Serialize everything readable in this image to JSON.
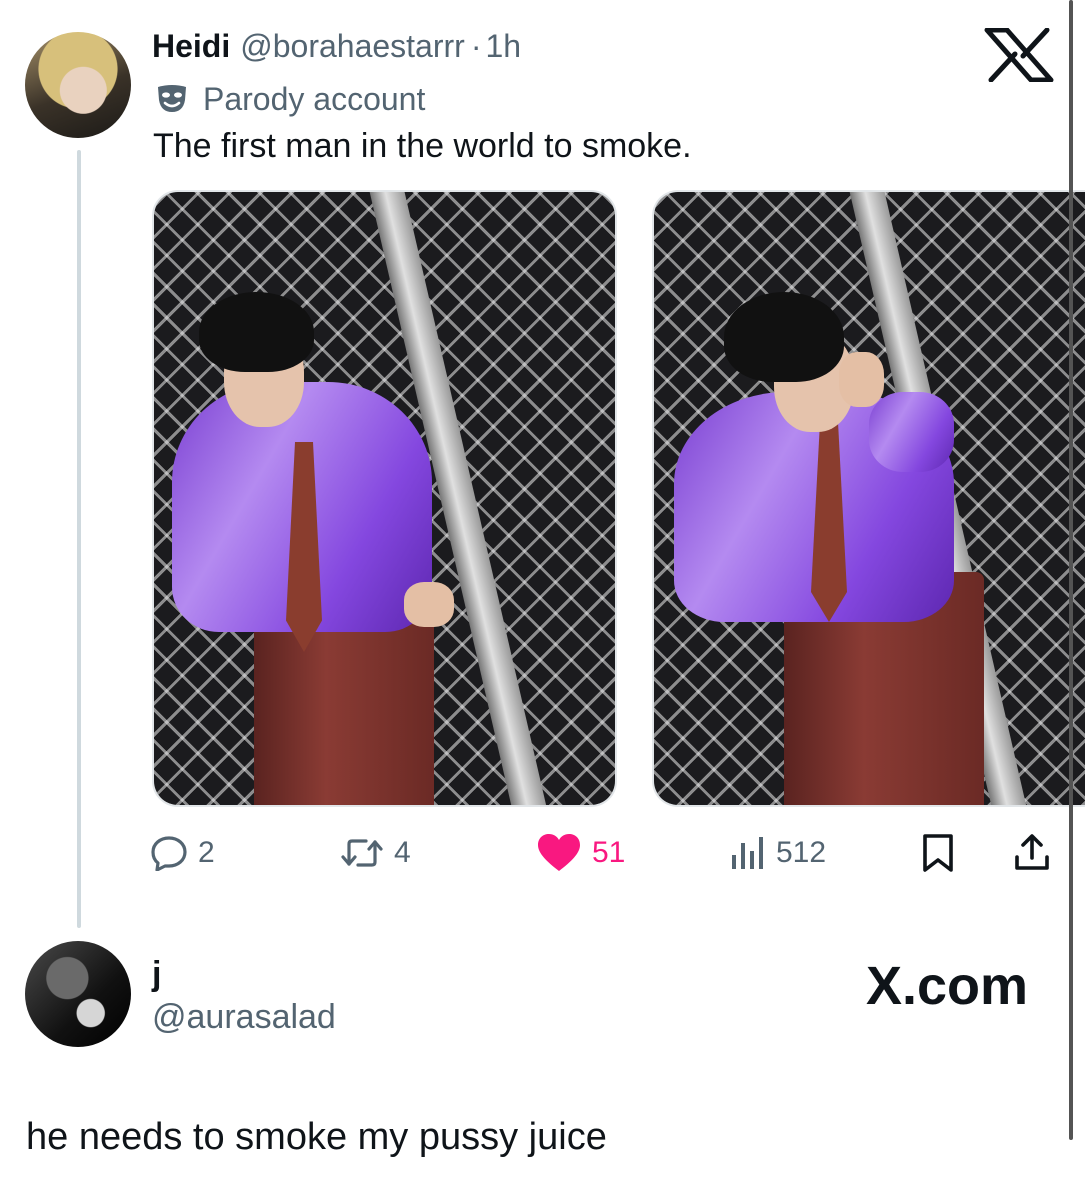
{
  "tweet": {
    "name": "Heidi",
    "handle": "@borahaestarrr",
    "separator": "·",
    "time": "1h",
    "label": "Parody account",
    "text": "The first man in the world to smoke.",
    "actions": {
      "replies": "2",
      "reposts": "4",
      "likes": "51",
      "views": "512"
    },
    "like_color": "#f91880"
  },
  "reply": {
    "name": "j",
    "handle": "@aurasalad",
    "text": "he needs to smoke my pussy juice"
  },
  "watermark": "X.com",
  "icons": [
    "x-logo-icon",
    "parody-mask-icon",
    "reply-icon",
    "repost-icon",
    "heart-icon",
    "views-icon",
    "bookmark-icon",
    "share-icon"
  ]
}
